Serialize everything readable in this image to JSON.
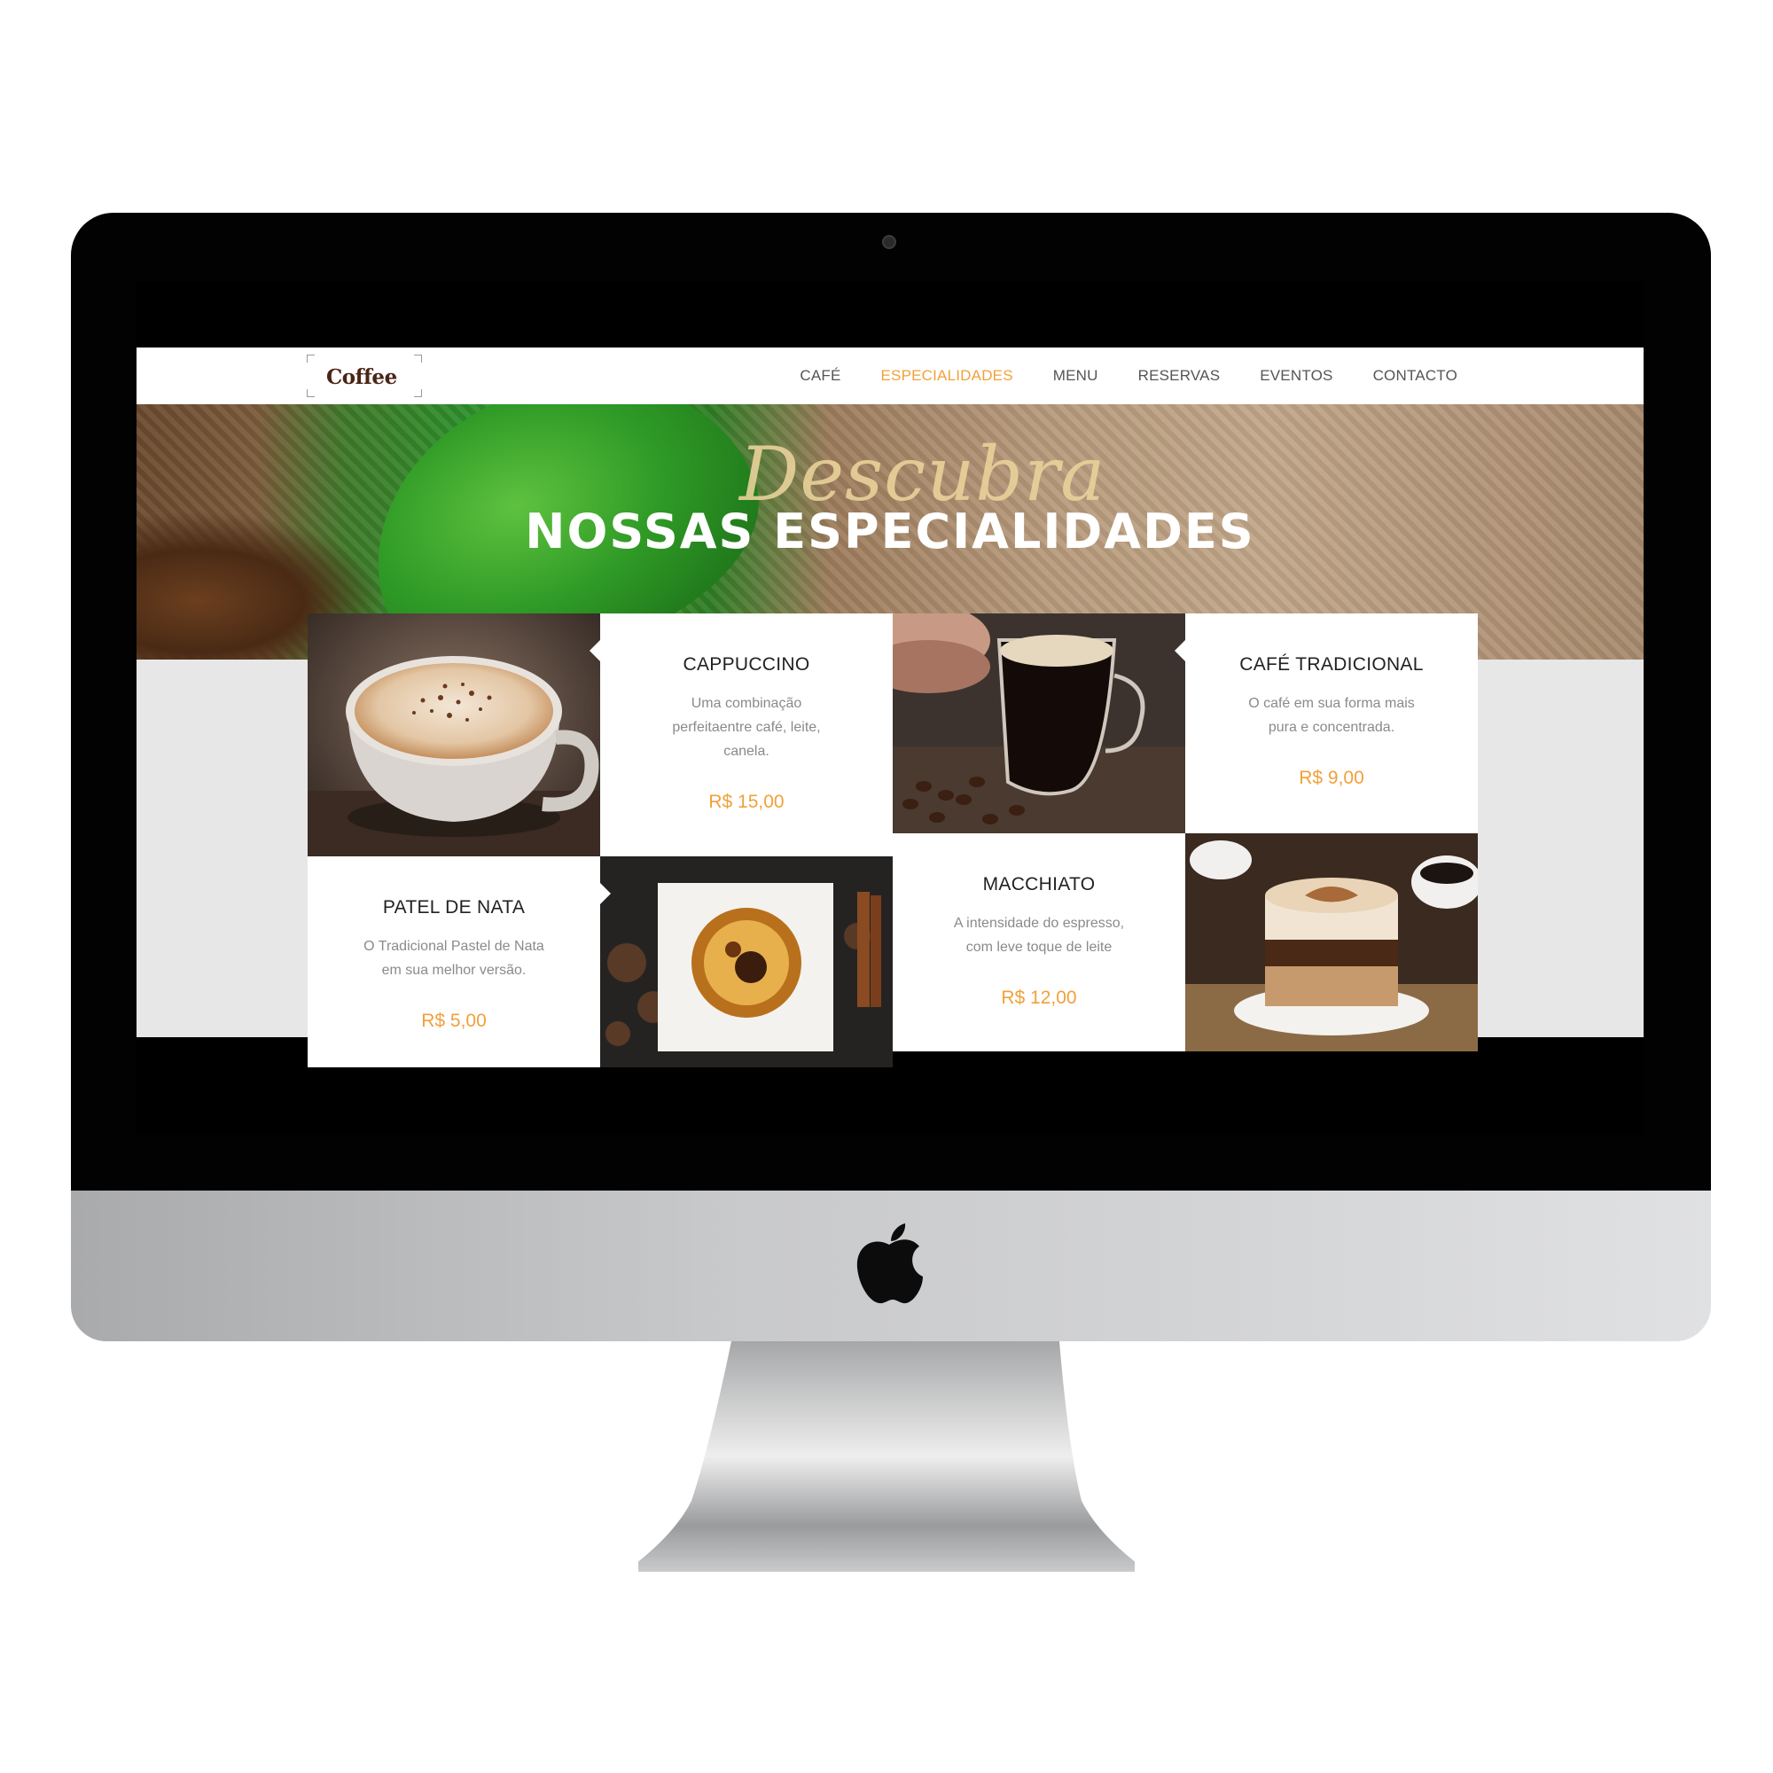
{
  "nav": {
    "logo_text": "Coffee",
    "items": [
      {
        "label": "CAFÉ",
        "active": false
      },
      {
        "label": "ESPECIALIDADES",
        "active": true
      },
      {
        "label": "MENU",
        "active": false
      },
      {
        "label": "RESERVAS",
        "active": false
      },
      {
        "label": "EVENTOS",
        "active": false
      },
      {
        "label": "CONTACTO",
        "active": false
      }
    ]
  },
  "hero": {
    "script": "Descubra",
    "title": "NOSSAS ESPECIALIDADES"
  },
  "products": [
    {
      "title": "CAPPUCCINO",
      "desc": "Uma combinação perfeitaentre café, leite, canela.",
      "price": "R$ 15,00"
    },
    {
      "title": "CAFÉ TRADICIONAL",
      "desc": "O café em sua forma mais pura e concentrada.",
      "price": "R$ 9,00"
    },
    {
      "title": "PATEL DE NATA",
      "desc": "O Tradicional Pastel de Nata em sua melhor versão.",
      "price": "R$ 5,00"
    },
    {
      "title": "MACCHIATO",
      "desc": "A intensidade do espresso, com leve toque de leite",
      "price": "R$ 12,00"
    }
  ],
  "images": [
    {
      "icon": "cappuccino-photo"
    },
    {
      "icon": "espresso-glass-photo"
    },
    {
      "icon": "pastel-de-nata-photo"
    },
    {
      "icon": "macchiato-photo"
    }
  ],
  "colors": {
    "accent": "#f2a03a",
    "nav_text": "#555555",
    "brand": "#4a2516"
  }
}
